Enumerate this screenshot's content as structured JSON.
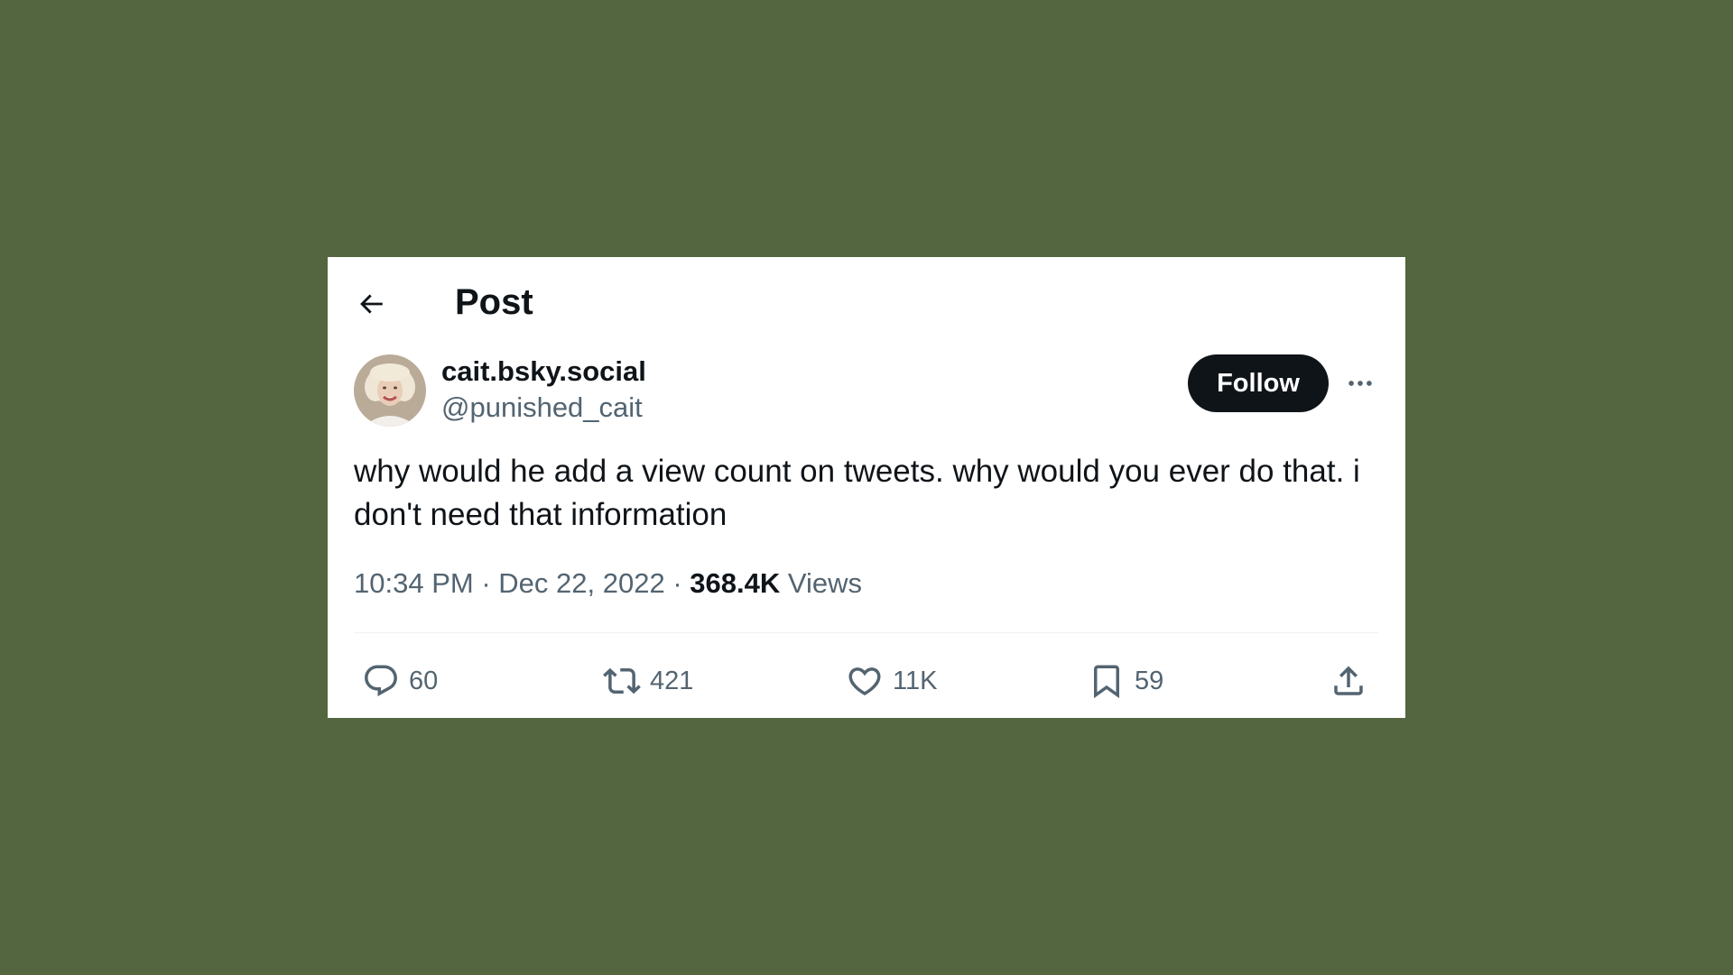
{
  "header": {
    "title": "Post",
    "back_icon": "arrow-left-icon"
  },
  "author": {
    "display_name": "cait.bsky.social",
    "handle": "@punished_cait",
    "avatar_icon": "avatar-photo"
  },
  "follow_label": "Follow",
  "more_icon": "more-dots-icon",
  "tweet": {
    "text": "why would he add a view count on tweets. why would you ever do that. i don't need that information",
    "time": "10:34 PM",
    "separator": "·",
    "date": "Dec 22, 2022",
    "views_count": "368.4K",
    "views_label": "Views"
  },
  "actions": {
    "replies": "60",
    "retweets": "421",
    "likes": "11K",
    "bookmarks": "59"
  },
  "colors": {
    "background": "#53663f",
    "card": "#ffffff",
    "text_primary": "#0f1419",
    "text_secondary": "#536471",
    "follow_bg": "#0f1419",
    "divider": "#eff3f4"
  }
}
